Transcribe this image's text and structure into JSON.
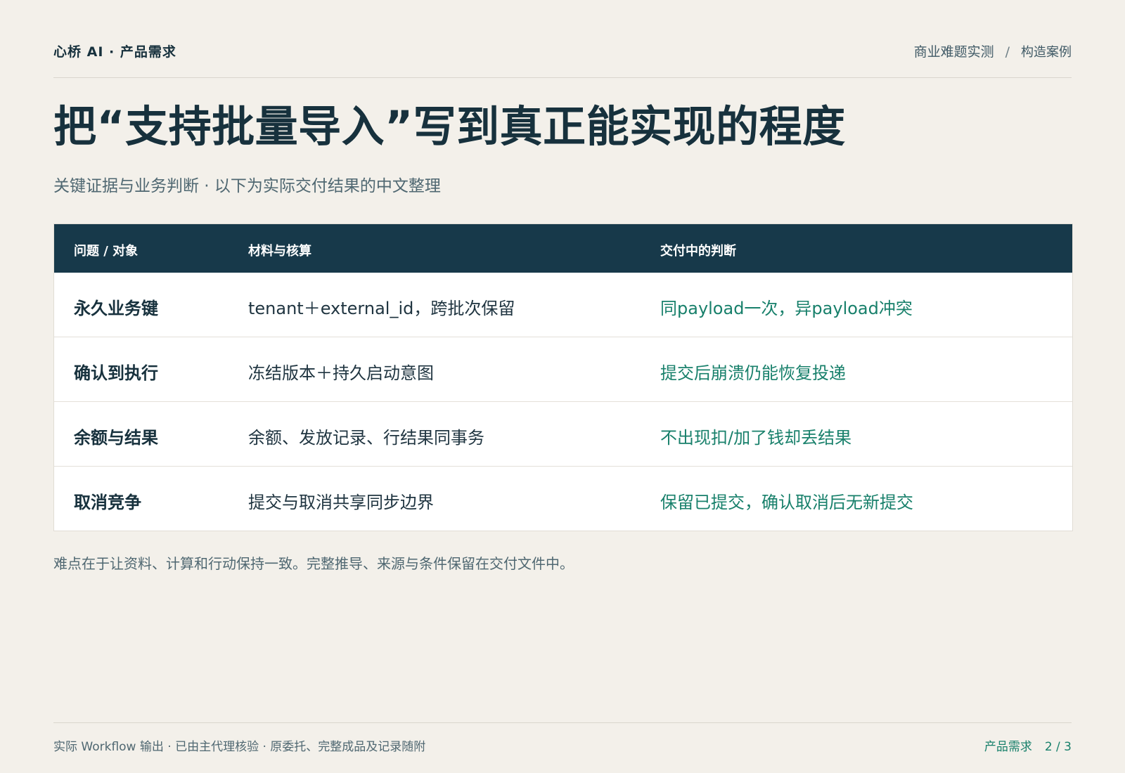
{
  "header": {
    "brand": "心桥 AI · 产品需求",
    "breadcrumb_main": "商业难题实测",
    "breadcrumb_sep": "/",
    "breadcrumb_sub": "构造案例"
  },
  "title": "把“支持批量导入”写到真正能实现的程度",
  "subtitle": "关键证据与业务判断 · 以下为实际交付结果的中文整理",
  "table": {
    "headers": [
      "问题 / 对象",
      "材料与核算",
      "交付中的判断"
    ],
    "rows": [
      {
        "issue": "永久业务键",
        "material": "tenant＋external_id，跨批次保留",
        "judgment": "同payload一次，异payload冲突"
      },
      {
        "issue": "确认到执行",
        "material": "冻结版本＋持久启动意图",
        "judgment": "提交后崩溃仍能恢复投递"
      },
      {
        "issue": "余额与结果",
        "material": "余额、发放记录、行结果同事务",
        "judgment": "不出现扣/加了钱却丢结果"
      },
      {
        "issue": "取消竞争",
        "material": "提交与取消共享同步边界",
        "judgment": "保留已提交，确认取消后无新提交"
      }
    ]
  },
  "note": "难点在于让资料、计算和行动保持一致。完整推导、来源与条件保留在交付文件中。",
  "footer": {
    "left": "实际 Workflow 输出 · 已由主代理核验 · 原委托、完整成品及记录随附",
    "section": "产品需求",
    "page": "2 / 3"
  },
  "colors": {
    "background": "#f3f0ea",
    "header_bar": "#17394a",
    "accent_green": "#18806b",
    "title": "#17313d"
  }
}
